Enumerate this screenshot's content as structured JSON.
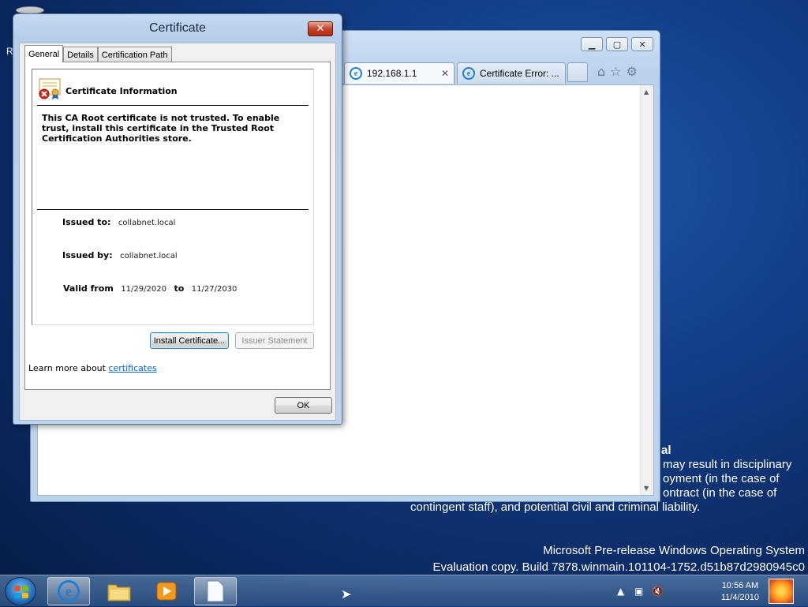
{
  "desktop": {
    "r_letter": "R",
    "notice_lines": [
      "al",
      "may result in disciplinary",
      "oyment (in the case of",
      "ontract (in the case of",
      "contingent staff), and potential civil and criminal liability."
    ],
    "build_line1": "Microsoft Pre-release Windows Operating System",
    "build_line2": "Evaluation copy. Build 7878.winmain.101104-1752.d51b87d2980945c0"
  },
  "browser": {
    "tabs": [
      {
        "label": "192.168.1.1",
        "active": true
      },
      {
        "label": "Certificate Error: ...",
        "active": false
      }
    ],
    "close_tab_glyph": "✕"
  },
  "dialog": {
    "title": "Certificate",
    "close_glyph": "✕",
    "tabs": [
      "General",
      "Details",
      "Certification Path"
    ],
    "info_title": "Certificate Information",
    "warning": "This CA Root certificate is not trusted. To enable trust, install this certificate in the Trusted Root Certification Authorities store.",
    "issued_to_label": "Issued to:",
    "issued_to": "collabnet.local",
    "issued_by_label": "Issued by:",
    "issued_by": "collabnet.local",
    "valid_from_label": "Valid from",
    "valid_from": "11/29/2020",
    "to_label": "to",
    "valid_to": "11/27/2030",
    "install_button": "Install Certificate...",
    "issuer_statement_button": "Issuer Statement",
    "learn_more_prefix": "Learn more about",
    "learn_more_link": "certificates",
    "ok_button": "OK"
  },
  "taskbar": {
    "time": "10:56 AM",
    "date": "11/4/2010"
  }
}
